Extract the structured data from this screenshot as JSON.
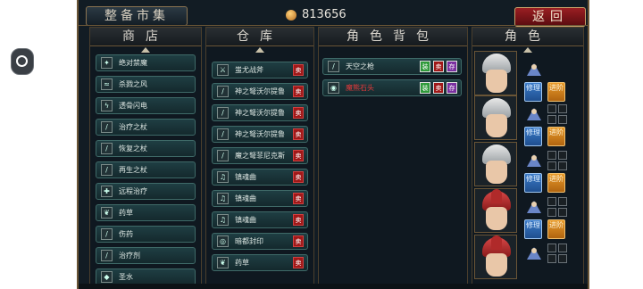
{
  "header": {
    "title": "整备市集",
    "money": "813656",
    "return_label": "返回"
  },
  "panels": {
    "shop": "商店",
    "storage": "仓库",
    "bag": "角色背包",
    "roles": "角色"
  },
  "shop_items": [
    {
      "label": "绝对禁魔",
      "icon": "✦"
    },
    {
      "label": "杀戮之风",
      "icon": "≈"
    },
    {
      "label": "透骨闪电",
      "icon": "ϟ"
    },
    {
      "label": "治疗之杖",
      "icon": "/"
    },
    {
      "label": "恢复之杖",
      "icon": "/"
    },
    {
      "label": "再生之杖",
      "icon": "/"
    },
    {
      "label": "远程治疗",
      "icon": "✚"
    },
    {
      "label": "药草",
      "icon": "❦"
    },
    {
      "label": "伤药",
      "icon": "/"
    },
    {
      "label": "治疗剂",
      "icon": "/"
    },
    {
      "label": "圣水",
      "icon": "◆"
    }
  ],
  "storage_items": [
    {
      "label": "蚩尤战斧",
      "icon": "⚔",
      "sell": "卖"
    },
    {
      "label": "神之弩沃尔提鲁",
      "icon": "/",
      "sell": "卖"
    },
    {
      "label": "神之弩沃尔提鲁",
      "icon": "/",
      "sell": "卖"
    },
    {
      "label": "神之弩沃尔提鲁",
      "icon": "/",
      "sell": "卖"
    },
    {
      "label": "魔之弩菲尼克斯",
      "icon": "/",
      "sell": "卖"
    },
    {
      "label": "镇魂曲",
      "icon": "♫",
      "sell": "卖"
    },
    {
      "label": "镇魂曲",
      "icon": "♫",
      "sell": "卖"
    },
    {
      "label": "镇魂曲",
      "icon": "♫",
      "sell": "卖"
    },
    {
      "label": "暗都封印",
      "icon": "◎",
      "sell": "卖"
    },
    {
      "label": "药草",
      "icon": "❦",
      "sell": "卖"
    }
  ],
  "bag_items": [
    {
      "label": "天空之枪",
      "icon": "/",
      "actions": [
        "装",
        "卖",
        "存"
      ],
      "label_color": "#dfe8e4"
    },
    {
      "label": "魔熊石头",
      "icon": "◉",
      "actions": [
        "装",
        "卖",
        "存"
      ],
      "label_color": "#e0393a"
    }
  ],
  "role_buttons": {
    "repair": "修理",
    "advance": "进阶"
  },
  "colors": {
    "accent_red": "#a01818",
    "item_teal": "#1f3e43",
    "repair_blue": "#2f6fb8",
    "advance_orange": "#d2841e"
  }
}
